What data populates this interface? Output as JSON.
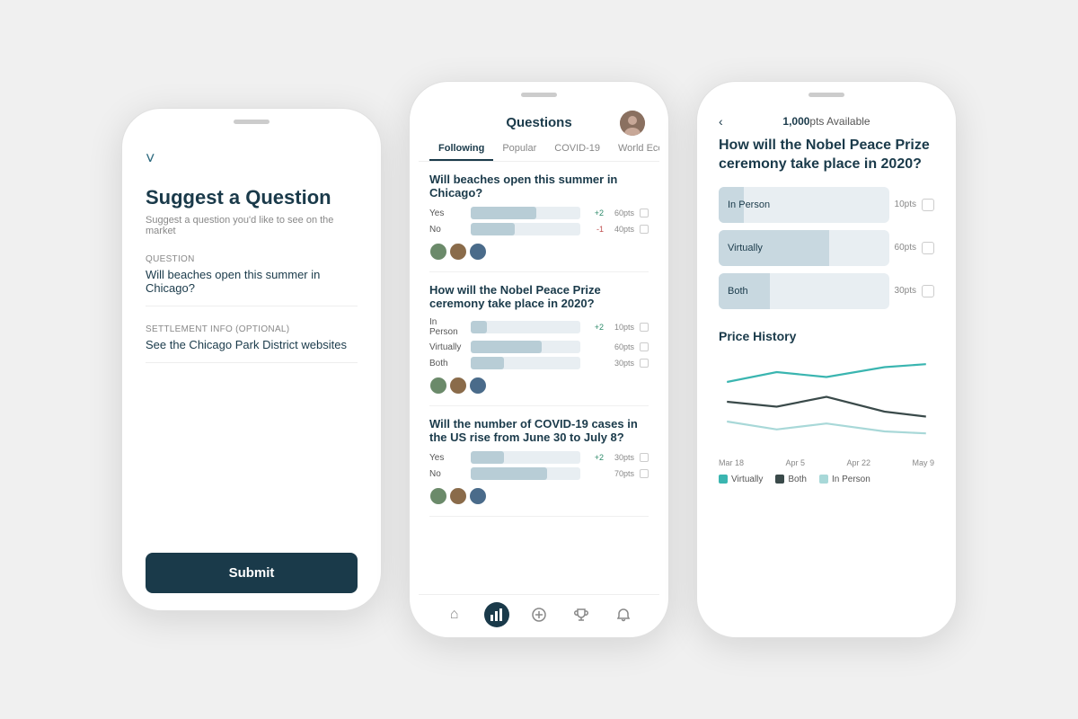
{
  "phone1": {
    "back_icon": "˅",
    "title": "Suggest a Question",
    "subtitle": "Suggest a question you'd like to see on the market",
    "question_label": "Question",
    "question_value": "Will beaches open this summer in Chicago?",
    "settlement_label": "Settlement Info (Optional)",
    "settlement_value": "See the Chicago Park District websites",
    "submit_label": "Submit"
  },
  "phone2": {
    "header_title": "Questions",
    "tabs": [
      "Following",
      "Popular",
      "COVID-19",
      "World Economics"
    ],
    "active_tab": "Following",
    "questions": [
      {
        "title": "Will beaches open this summer in Chicago?",
        "options": [
          {
            "label": "Yes",
            "fill": 60,
            "delta": "+2",
            "pts": "60pts"
          },
          {
            "label": "No",
            "fill": 40,
            "delta": "-1",
            "pts": "40pts"
          }
        ]
      },
      {
        "title": "How will the Nobel Peace Prize ceremony take place in 2020?",
        "options": [
          {
            "label": "In Person",
            "fill": 15,
            "delta": "+2",
            "pts": "10pts"
          },
          {
            "label": "Virtually",
            "fill": 65,
            "delta": "",
            "pts": "60pts"
          },
          {
            "label": "Both",
            "fill": 30,
            "delta": "",
            "pts": "30pts"
          }
        ]
      },
      {
        "title": "Will the number of COVID-19 cases in the US rise from June 30 to July 8?",
        "options": [
          {
            "label": "Yes",
            "fill": 30,
            "delta": "+2",
            "pts": "30pts"
          },
          {
            "label": "No",
            "fill": 70,
            "delta": "",
            "pts": "70pts"
          }
        ]
      }
    ],
    "nav_icons": [
      "⌂",
      "▐▌",
      "⊕",
      "🏆",
      "🔔"
    ]
  },
  "phone3": {
    "back_icon": "‹",
    "pts_available": "1,000pts Available",
    "pts_num": "1,000",
    "question": "How will the Nobel Peace Prize ceremony take place in 2020?",
    "options": [
      {
        "label": "In Person",
        "fill": 15,
        "pts": "10pts"
      },
      {
        "label": "Virtually",
        "fill": 65,
        "pts": "60pts"
      },
      {
        "label": "Both",
        "fill": 30,
        "pts": "30pts"
      }
    ],
    "price_history_title": "Price History",
    "chart_labels": [
      "Mar 18",
      "Apr 5",
      "Apr 22",
      "May 9"
    ],
    "legend": [
      {
        "color": "#3ab5b0",
        "label": "Virtually"
      },
      {
        "color": "#3a4a4a",
        "label": "Both"
      },
      {
        "color": "#a8d8d8",
        "label": "In Person"
      }
    ]
  }
}
